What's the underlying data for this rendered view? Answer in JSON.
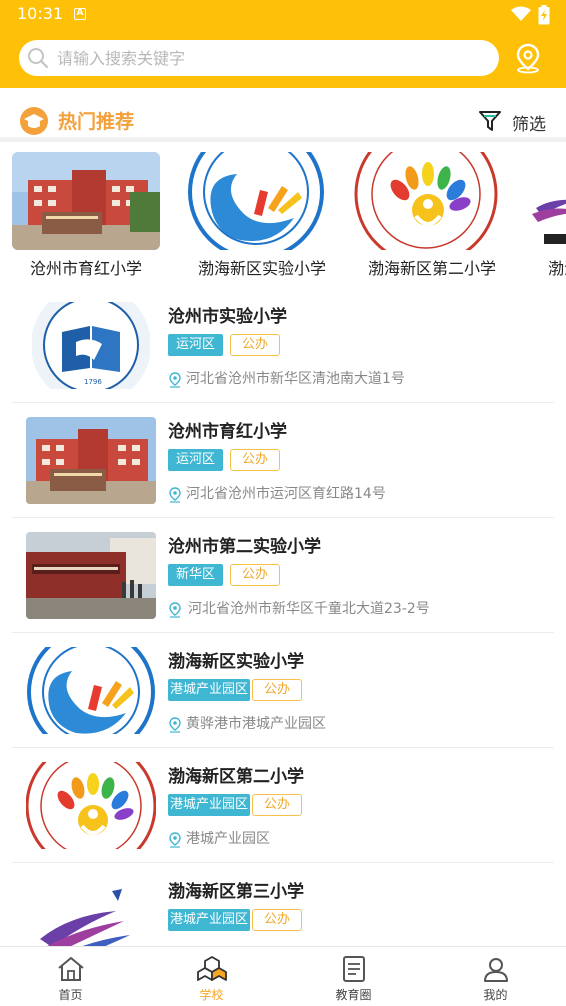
{
  "status_bar": {
    "time": "10:31",
    "a_icon_label": "A"
  },
  "search": {
    "placeholder": "请输入搜索关键字"
  },
  "section": {
    "title": "热门推荐",
    "filter_label": "筛选"
  },
  "carousel": [
    {
      "name": "沧州市育红小学",
      "image": "school-building-photo"
    },
    {
      "name": "渤海新区实验小学",
      "image": "wave-logo"
    },
    {
      "name": "渤海新区第二小学",
      "image": "rainbow-logo"
    },
    {
      "name": "渤海新区第三小学",
      "image": "brush-logo"
    }
  ],
  "schools": [
    {
      "name": "沧州市实验小学",
      "district": "运河区",
      "type": "公办",
      "address": "河北省沧州市新华区清池南大道1号",
      "image": "badge-logo"
    },
    {
      "name": "沧州市育红小学",
      "district": "运河区",
      "type": "公办",
      "address": "河北省沧州市运河区育红路14号",
      "image": "school-building-photo"
    },
    {
      "name": "沧州市第二实验小学",
      "district": "新华区",
      "type": "公办",
      "address": "河北省沧州市新华区千童北大道23-2号",
      "image": "school-gate-photo"
    },
    {
      "name": "渤海新区实验小学",
      "district": "港城产业园区",
      "type": "公办",
      "address": "黄骅港市港城产业园区",
      "image": "wave-logo"
    },
    {
      "name": "渤海新区第二小学",
      "district": "港城产业园区",
      "type": "公办",
      "address": "港城产业园区",
      "image": "rainbow-logo"
    },
    {
      "name": "渤海新区第三小学",
      "district": "港城产业园区",
      "type": "公办",
      "address": "",
      "image": "brush-logo"
    }
  ],
  "tabs": [
    {
      "label": "首页",
      "icon": "home-icon",
      "active": false
    },
    {
      "label": "学校",
      "icon": "cubes-icon",
      "active": true
    },
    {
      "label": "教育圈",
      "icon": "book-icon",
      "active": false
    },
    {
      "label": "我的",
      "icon": "person-icon",
      "active": false
    }
  ],
  "colors": {
    "header": "#FFC107",
    "accent": "#F5A623",
    "district_tag": "#3FB6D2",
    "type_tag": "#F0A92D"
  }
}
